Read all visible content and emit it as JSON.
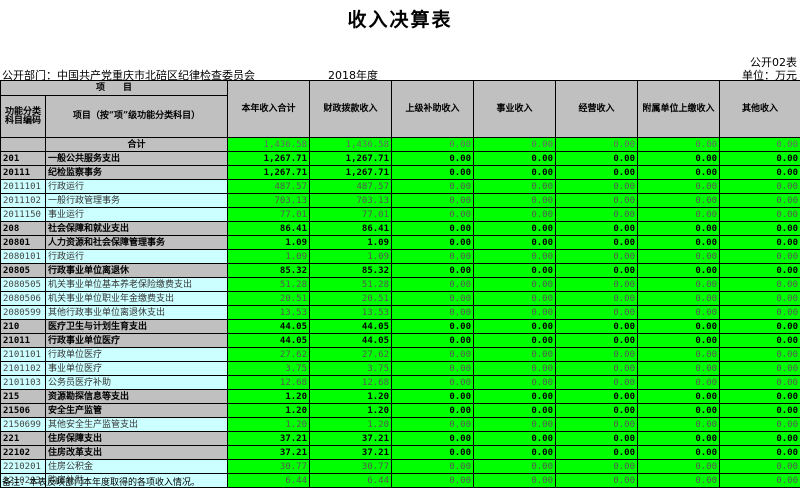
{
  "title": "收入决算表",
  "form_code": "公开02表",
  "department": "公开部门：中国共产党重庆市北碚区纪律检查委员会",
  "year": "2018年度",
  "unit": "单位：万元",
  "header": {
    "item_group": "项　　目",
    "code_col": "功能分类科目编码",
    "name_col": "项目（按“项”级功能分类科目）",
    "columns": [
      "本年收入合计",
      "财政拨款收入",
      "上级补助收入",
      "事业收入",
      "经营收入",
      "附属单位上缴收入",
      "其他收入"
    ]
  },
  "rows": [
    {
      "code": "",
      "name": "合计",
      "level": "total",
      "values": [
        "1,436.58",
        "1,436.58",
        "0.00",
        "0.00",
        "0.00",
        "0.00",
        "0.00"
      ]
    },
    {
      "code": "201",
      "name": "一般公共服务支出",
      "level": "lvl0",
      "values": [
        "1,267.71",
        "1,267.71",
        "0.00",
        "0.00",
        "0.00",
        "0.00",
        "0.00"
      ]
    },
    {
      "code": "20111",
      "name": "纪检监察事务",
      "level": "lvl1",
      "values": [
        "1,267.71",
        "1,267.71",
        "0.00",
        "0.00",
        "0.00",
        "0.00",
        "0.00"
      ]
    },
    {
      "code": "2011101",
      "name": "行政运行",
      "level": "lvl2",
      "values": [
        "487.57",
        "487.57",
        "0.00",
        "0.00",
        "0.00",
        "0.00",
        "0.00"
      ]
    },
    {
      "code": "2011102",
      "name": "一般行政管理事务",
      "level": "lvl2",
      "values": [
        "703.13",
        "703.13",
        "0.00",
        "0.00",
        "0.00",
        "0.00",
        "0.00"
      ]
    },
    {
      "code": "2011150",
      "name": "事业运行",
      "level": "lvl2",
      "values": [
        "77.01",
        "77.01",
        "0.00",
        "0.00",
        "0.00",
        "0.00",
        "0.00"
      ]
    },
    {
      "code": "208",
      "name": "社会保障和就业支出",
      "level": "lvl0",
      "values": [
        "86.41",
        "86.41",
        "0.00",
        "0.00",
        "0.00",
        "0.00",
        "0.00"
      ]
    },
    {
      "code": "20801",
      "name": "人力资源和社会保障管理事务",
      "level": "lvl1",
      "values": [
        "1.09",
        "1.09",
        "0.00",
        "0.00",
        "0.00",
        "0.00",
        "0.00"
      ]
    },
    {
      "code": "2080101",
      "name": "行政运行",
      "level": "lvl2",
      "values": [
        "1.09",
        "1.09",
        "0.00",
        "0.00",
        "0.00",
        "0.00",
        "0.00"
      ]
    },
    {
      "code": "20805",
      "name": "行政事业单位离退休",
      "level": "lvl1",
      "values": [
        "85.32",
        "85.32",
        "0.00",
        "0.00",
        "0.00",
        "0.00",
        "0.00"
      ]
    },
    {
      "code": "2080505",
      "name": "机关事业单位基本养老保险缴费支出",
      "level": "lvl2",
      "values": [
        "51.28",
        "51.28",
        "0.00",
        "0.00",
        "0.00",
        "0.00",
        "0.00"
      ]
    },
    {
      "code": "2080506",
      "name": "机关事业单位职业年金缴费支出",
      "level": "lvl2",
      "values": [
        "20.51",
        "20.51",
        "0.00",
        "0.00",
        "0.00",
        "0.00",
        "0.00"
      ]
    },
    {
      "code": "2080599",
      "name": "其他行政事业单位离退休支出",
      "level": "lvl2",
      "values": [
        "13.53",
        "13.53",
        "0.00",
        "0.00",
        "0.00",
        "0.00",
        "0.00"
      ]
    },
    {
      "code": "210",
      "name": "医疗卫生与计划生育支出",
      "level": "lvl0",
      "values": [
        "44.05",
        "44.05",
        "0.00",
        "0.00",
        "0.00",
        "0.00",
        "0.00"
      ]
    },
    {
      "code": "21011",
      "name": "行政事业单位医疗",
      "level": "lvl1",
      "values": [
        "44.05",
        "44.05",
        "0.00",
        "0.00",
        "0.00",
        "0.00",
        "0.00"
      ]
    },
    {
      "code": "2101101",
      "name": "行政单位医疗",
      "level": "lvl2",
      "values": [
        "27.62",
        "27.62",
        "0.00",
        "0.00",
        "0.00",
        "0.00",
        "0.00"
      ]
    },
    {
      "code": "2101102",
      "name": "事业单位医疗",
      "level": "lvl2",
      "values": [
        "3.75",
        "3.75",
        "0.00",
        "0.00",
        "0.00",
        "0.00",
        "0.00"
      ]
    },
    {
      "code": "2101103",
      "name": "公务员医疗补助",
      "level": "lvl2",
      "values": [
        "12.68",
        "12.68",
        "0.00",
        "0.00",
        "0.00",
        "0.00",
        "0.00"
      ]
    },
    {
      "code": "215",
      "name": "资源勘探信息等支出",
      "level": "lvl0",
      "values": [
        "1.20",
        "1.20",
        "0.00",
        "0.00",
        "0.00",
        "0.00",
        "0.00"
      ]
    },
    {
      "code": "21506",
      "name": "安全生产监管",
      "level": "lvl1",
      "values": [
        "1.20",
        "1.20",
        "0.00",
        "0.00",
        "0.00",
        "0.00",
        "0.00"
      ]
    },
    {
      "code": "2150699",
      "name": "其他安全生产监管支出",
      "level": "lvl2",
      "values": [
        "1.20",
        "1.20",
        "0.00",
        "0.00",
        "0.00",
        "0.00",
        "0.00"
      ]
    },
    {
      "code": "221",
      "name": "住房保障支出",
      "level": "lvl0",
      "values": [
        "37.21",
        "37.21",
        "0.00",
        "0.00",
        "0.00",
        "0.00",
        "0.00"
      ]
    },
    {
      "code": "22102",
      "name": "住房改革支出",
      "level": "lvl1",
      "values": [
        "37.21",
        "37.21",
        "0.00",
        "0.00",
        "0.00",
        "0.00",
        "0.00"
      ]
    },
    {
      "code": "2210201",
      "name": "住房公积金",
      "level": "lvl2",
      "values": [
        "30.77",
        "30.77",
        "0.00",
        "0.00",
        "0.00",
        "0.00",
        "0.00"
      ]
    },
    {
      "code": "2210203",
      "name": "购房补贴",
      "level": "lvl2",
      "values": [
        "6.44",
        "6.44",
        "0.00",
        "0.00",
        "0.00",
        "0.00",
        "0.00"
      ]
    }
  ],
  "note": "备注：本表反映部门本年度取得的各项收入情况。",
  "colors": {
    "green_cell": "#00ff00",
    "header_gray": "#c0c0c0",
    "detail_cyan": "#ccffff"
  }
}
